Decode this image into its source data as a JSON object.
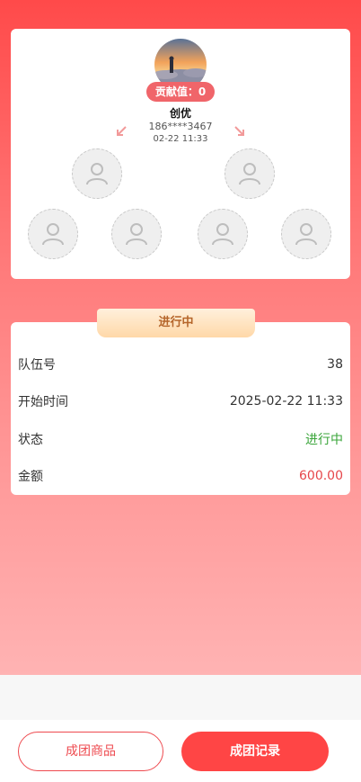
{
  "leader": {
    "contribution": "贡献值：0",
    "name": "创优",
    "phone": "186****3467",
    "time": "02-22 11:33"
  },
  "members": {
    "slots_icon": "user-placeholder-icon",
    "level1_count": 2,
    "level2_count": 4
  },
  "status_tab": {
    "label": "进行中"
  },
  "info": [
    {
      "label": "队伍号",
      "value": "38"
    },
    {
      "label": "开始时间",
      "value": "2025-02-22 11:33"
    },
    {
      "label": "状态",
      "value": "进行中"
    },
    {
      "label": "金额",
      "value": "600.00"
    }
  ],
  "bottom": {
    "goods_button": "成团商品",
    "records_button": "成团记录"
  },
  "colors": {
    "primary": "#ff4545",
    "status_green": "#3aa53a",
    "amount_red": "#e6464a"
  }
}
